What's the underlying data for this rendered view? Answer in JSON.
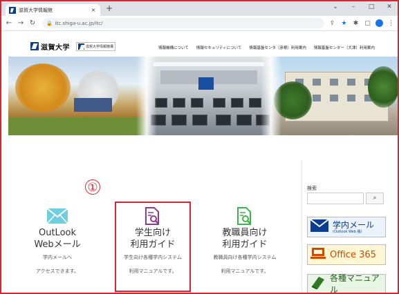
{
  "browser": {
    "tab_title": "滋賀大学情報館",
    "tab_close": "×",
    "new_tab": "+",
    "url": "itc.shiga-u.ac.jp/itc/",
    "win_minimize": "–",
    "win_maximize": "□",
    "win_close": "✕",
    "chevron": "⌄"
  },
  "header": {
    "logo_text": "滋賀大学",
    "center_logo_text": "滋賀大学情報機構",
    "nav": [
      "情報機構について",
      "情報セキュリティについて",
      "情報基盤センタ（彦根）利用案内",
      "情報基盤センター（大津）利用案内"
    ]
  },
  "annotation": {
    "marker": "①"
  },
  "cards": [
    {
      "title1": "OutLook",
      "title2": "Webメール",
      "desc1": "学内メールへ",
      "desc2": "アクセスできます。",
      "icon": "mail-icon",
      "color": "#6fcfe0"
    },
    {
      "title1": "学生向け",
      "title2": "利用ガイド",
      "desc1": "学生向け各種学内システム",
      "desc2": "利用マニュアルです。",
      "icon": "document-search-icon",
      "color": "#8e3a8e"
    },
    {
      "title1": "教職員向け",
      "title2": "利用ガイド",
      "desc1": "教職員向け各種学内システム",
      "desc2": "利用マニュアルです。",
      "icon": "document-search-icon",
      "color": "#3db24a"
    }
  ],
  "sidebar": {
    "search_label": "検索",
    "search_button": "⌕",
    "mail_title": "学内メール",
    "mail_sub": "(Outlook Web 版)",
    "office_title": "Office 365",
    "manual_title": "各種マニュアル"
  },
  "colors": {
    "highlight": "#d9232e",
    "brand_blue": "#0b3d91"
  }
}
